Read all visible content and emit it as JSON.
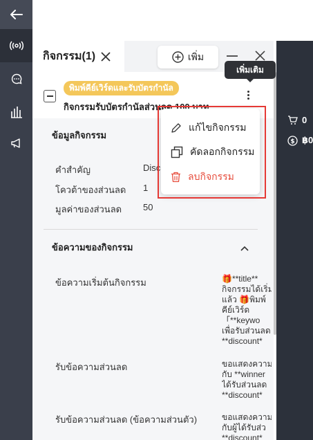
{
  "rail": {
    "back_icon": "arrow-left-icon",
    "items": [
      {
        "icon": "broadcast-icon",
        "active": true
      },
      {
        "icon": "chat-bubble-icon"
      },
      {
        "icon": "store-chart-icon"
      },
      {
        "icon": "megaphone-icon"
      }
    ]
  },
  "header": {
    "title": "กิจกรรม(1)",
    "add_label": "เพิ่ม"
  },
  "tooltip": "เพิ่มเติม",
  "activity": {
    "type_tag": "พิมพ์คีย์เวิร์ดและรับบัตรกำนัล",
    "name": "กิจกรรมรับบัตรกำนัลส่วนลด 100 บาท"
  },
  "menu": {
    "edit": "แก้ไขกิจกรรม",
    "copy": "คัดลอกกิจกรรม",
    "delete": "ลบกิจกรรม"
  },
  "info_section": {
    "title": "ข้อมูลกิจกรรม",
    "rows": [
      {
        "label": "คำสำคัญ",
        "value": "Disc"
      },
      {
        "label": "โควต้าของส่วนลด",
        "value": "1"
      },
      {
        "label": "มูลค่าของส่วนลด",
        "value": "50"
      }
    ]
  },
  "message_section": {
    "title": "ข้อความของกิจกรรม",
    "rows": [
      {
        "label": "ข้อความเริ่มต้นกิจกรรม",
        "value": "🎁**title**\nกิจกรรมได้เริ่ม\nแล้ว 🎁พิมพ์\nคีย์เวิร์ด\n「**keywo\nเพื่อรับส่วนลด\n**discount*"
      },
      {
        "label": "รับข้อความส่วนลด",
        "value": "ขอแสดงความ\nกับ **winner\nได้รับส่วนลด\n**discount*"
      },
      {
        "label": "รับข้อความส่วนลด (ข้อความส่วนตัว)",
        "value": "ขอแสดงความ\nกับผู้ได้รับส่ว\n**discount*"
      }
    ]
  },
  "right_panel": {
    "cart_count": "0",
    "coin_amount": "฿0"
  },
  "colors": {
    "tag": "#f4c75a",
    "danger": "#e74c3c",
    "highlight": "#e53935",
    "rail": "#3a3f4b"
  }
}
